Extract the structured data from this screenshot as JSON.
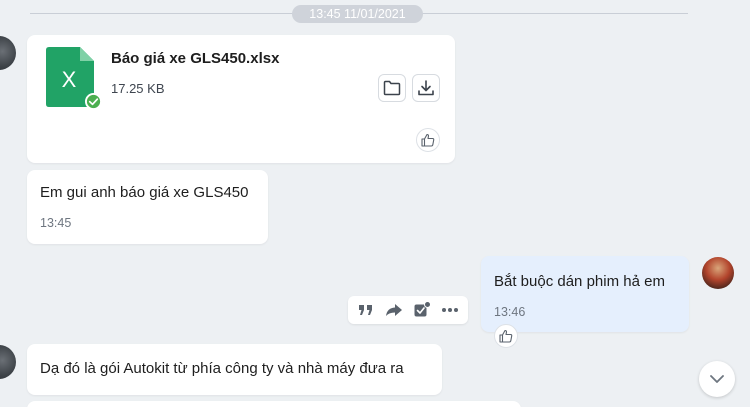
{
  "date_separator": "13:45 11/01/2021",
  "file_message": {
    "file_name": "Báo giá xe GLS450.xlsx",
    "file_size": "17.25 KB",
    "file_type_letter": "X",
    "icons": [
      "excel-file-icon",
      "verified-check-icon",
      "folder-icon",
      "download-icon",
      "thumbs-up-icon"
    ]
  },
  "messages": [
    {
      "text": "Em gui anh báo giá xe GLS450",
      "time": "13:45"
    },
    {
      "text": "Bắt buộc dán phim hả em",
      "time": "13:46"
    },
    {
      "text": "Dạ đó là gói Autokit từ phía công ty và nhà máy đưa ra"
    }
  ],
  "action_bar": [
    "quote-icon",
    "forward-icon",
    "task-icon",
    "more-icon"
  ],
  "colors": {
    "background": "#edf0f3",
    "bubble_other": "#ffffff",
    "bubble_me": "#e5effd",
    "excel_green": "#21a366",
    "check_green": "#4caf50"
  }
}
